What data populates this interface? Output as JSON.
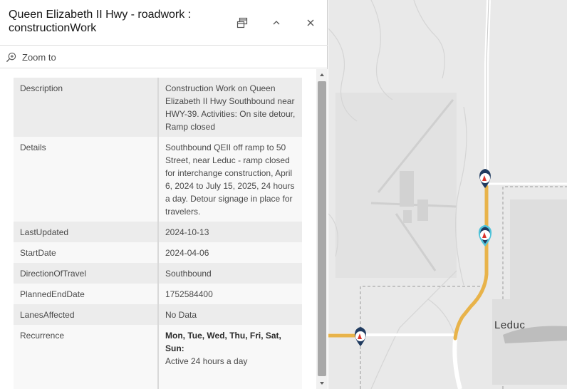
{
  "popup": {
    "title": "Queen Elizabeth II Hwy - roadwork : constructionWork",
    "zoom_to_label": "Zoom to"
  },
  "attributes": [
    {
      "key": "Description",
      "value": "Construction Work on Queen Elizabeth II Hwy Southbound near HWY-39. Activities: On site detour, Ramp closed"
    },
    {
      "key": "Details",
      "value": "Southbound QEII off ramp to 50 Street, near Leduc - ramp closed for interchange construction, April 6, 2024 to July 15, 2025, 24 hours a day. Detour signage in place for travelers."
    },
    {
      "key": "LastUpdated",
      "value": "2024-10-13"
    },
    {
      "key": "StartDate",
      "value": "2024-04-06"
    },
    {
      "key": "DirectionOfTravel",
      "value": "Southbound"
    },
    {
      "key": "PlannedEndDate",
      "value": "1752584400"
    },
    {
      "key": "LanesAffected",
      "value": "No Data"
    },
    {
      "key": "Recurrence",
      "value_bold": "Mon, Tue, Wed, Thu, Fri, Sat, Sun:",
      "value": "Active 24 hours a day"
    }
  ],
  "map": {
    "place_label": "Leduc",
    "colors": {
      "road_highlight": "#e8b34a",
      "marker_fill": "#1f3a5f",
      "marker_selected_ring": "#4fc3d9",
      "marker_icon": "#d9342b",
      "basemap": "#e9e9e9"
    },
    "markers": [
      {
        "name": "roadwork-marker",
        "selected": false
      },
      {
        "name": "roadwork-marker",
        "selected": true
      },
      {
        "name": "roadwork-marker",
        "selected": false
      }
    ]
  },
  "icons": {
    "dock": "dock-icon",
    "collapse": "chevron-up-icon",
    "close": "close-icon",
    "zoom": "zoom-in-icon"
  }
}
